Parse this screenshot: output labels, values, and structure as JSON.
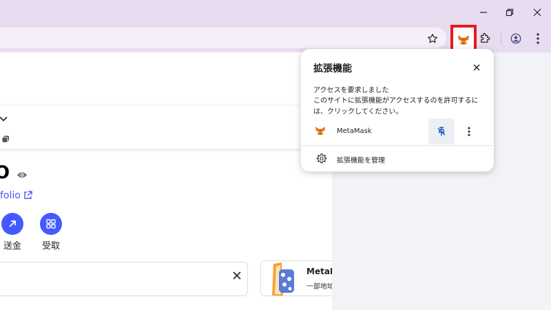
{
  "browser": {
    "toolbar_icons": [
      "star-icon",
      "metamask-fox-icon",
      "puzzle-icon",
      "profile-icon",
      "kebab-menu-icon"
    ],
    "window_controls": [
      "minimize-icon",
      "restore-icon",
      "close-icon"
    ],
    "highlight_color": "#e8191f"
  },
  "popup": {
    "title": "拡張機能",
    "access_heading": "アクセスを要求しました",
    "access_description": "このサイトに拡張機能がアクセスするのを許可するには、クリックしてください。",
    "extension_name": "MetaMask",
    "manage_label": "拡張機能を管理"
  },
  "page": {
    "balance_partial": "O",
    "portfolio_partial": "folio",
    "actions": [
      {
        "label": "送金",
        "icon": "arrow-up-right-icon"
      },
      {
        "label": "受取",
        "icon": "qr-scan-icon"
      }
    ],
    "promo_title_partial": "MetaM",
    "promo_sub_partial": "一部地域",
    "accent_color": "#4459ff"
  }
}
